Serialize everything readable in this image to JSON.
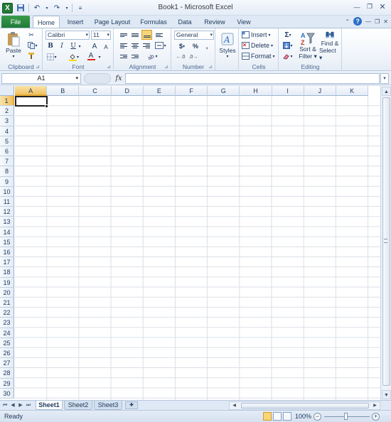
{
  "window": {
    "title": "Book1 - Microsoft Excel",
    "app_icon": "X"
  },
  "tabs": {
    "file": "File",
    "items": [
      {
        "label": "Home",
        "active": true
      },
      {
        "label": "Insert"
      },
      {
        "label": "Page Layout"
      },
      {
        "label": "Formulas"
      },
      {
        "label": "Data"
      },
      {
        "label": "Review"
      },
      {
        "label": "View"
      }
    ]
  },
  "ribbon": {
    "clipboard": {
      "label": "Clipboard",
      "paste": "Paste"
    },
    "font": {
      "label": "Font",
      "name": "Calibri",
      "size": "11",
      "bold": "B",
      "italic": "I",
      "underline": "U",
      "grow": "A",
      "shrink": "A",
      "font_color": "A"
    },
    "alignment": {
      "label": "Alignment"
    },
    "number": {
      "label": "Number",
      "format": "General",
      "currency": "$",
      "percent": "%",
      "comma": ","
    },
    "styles": {
      "label": "Styles"
    },
    "cells": {
      "label": "Cells",
      "insert": "Insert",
      "delete": "Delete",
      "format": "Format"
    },
    "editing": {
      "label": "Editing",
      "sum": "Σ",
      "sort": "Sort &",
      "filter": "Filter",
      "find": "Find &",
      "select": "Select"
    }
  },
  "formula_bar": {
    "name_box": "A1",
    "fx": "fx",
    "value": ""
  },
  "grid": {
    "columns": [
      "A",
      "B",
      "C",
      "D",
      "E",
      "F",
      "G",
      "H",
      "I",
      "J",
      "K"
    ],
    "rows": [
      "1",
      "2",
      "3",
      "4",
      "5",
      "6",
      "7",
      "8",
      "9",
      "10",
      "11",
      "12",
      "13",
      "14",
      "15",
      "16",
      "17",
      "18",
      "19",
      "20",
      "21",
      "22",
      "23",
      "24",
      "25",
      "26",
      "27",
      "28",
      "29",
      "30"
    ],
    "selected_cell": "A1"
  },
  "sheets": [
    "Sheet1",
    "Sheet2",
    "Sheet3"
  ],
  "status": {
    "text": "Ready",
    "zoom": "100%"
  }
}
